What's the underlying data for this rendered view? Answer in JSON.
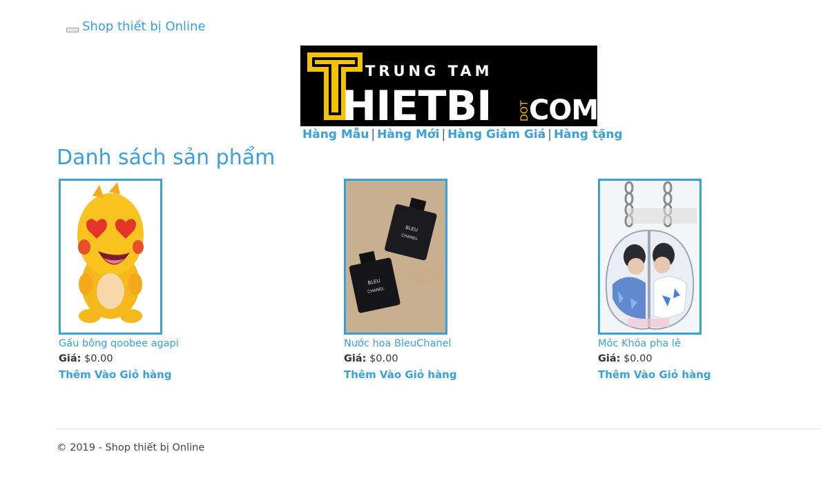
{
  "navbar": {
    "brand": "Shop thiết bị Online"
  },
  "banner": {
    "big_letter": "T",
    "line1": "TRUNG TAM",
    "line2": "HIETBI",
    "dot": "DOT",
    "com": "COM",
    "colors": {
      "background": "#000000",
      "accent": "#f5c200",
      "text": "#ffffff"
    }
  },
  "menu": {
    "items": [
      "Hàng Mẫu",
      "Hàng Mới",
      "Hàng Giảm Giá",
      "Hàng tặng"
    ],
    "separator": "|"
  },
  "page": {
    "title": "Danh sách sản phẩm"
  },
  "products": [
    {
      "name": "Gấu bông qoobee agapi",
      "price_label": "Giá:",
      "price": "$0.00",
      "add_label": "Thêm Vào Giỏ hàng",
      "image": "plush-dinosaur"
    },
    {
      "name": "Nước hoa BleuChanel",
      "price_label": "Giá:",
      "price": "$0.00",
      "add_label": "Thêm Vào Giỏ hàng",
      "image": "perfume-bottles",
      "image_text": [
        "BLEU",
        "CHANEL"
      ]
    },
    {
      "name": "Móc Khóa pha lê",
      "price_label": "Giá:",
      "price": "$0.00",
      "add_label": "Thêm Vào Giỏ hàng",
      "image": "crystal-keychain"
    }
  ],
  "footer": {
    "text": "© 2019 - Shop thiết bị Online"
  },
  "colors": {
    "accent": "#3aa0dc",
    "text": "#333333"
  }
}
